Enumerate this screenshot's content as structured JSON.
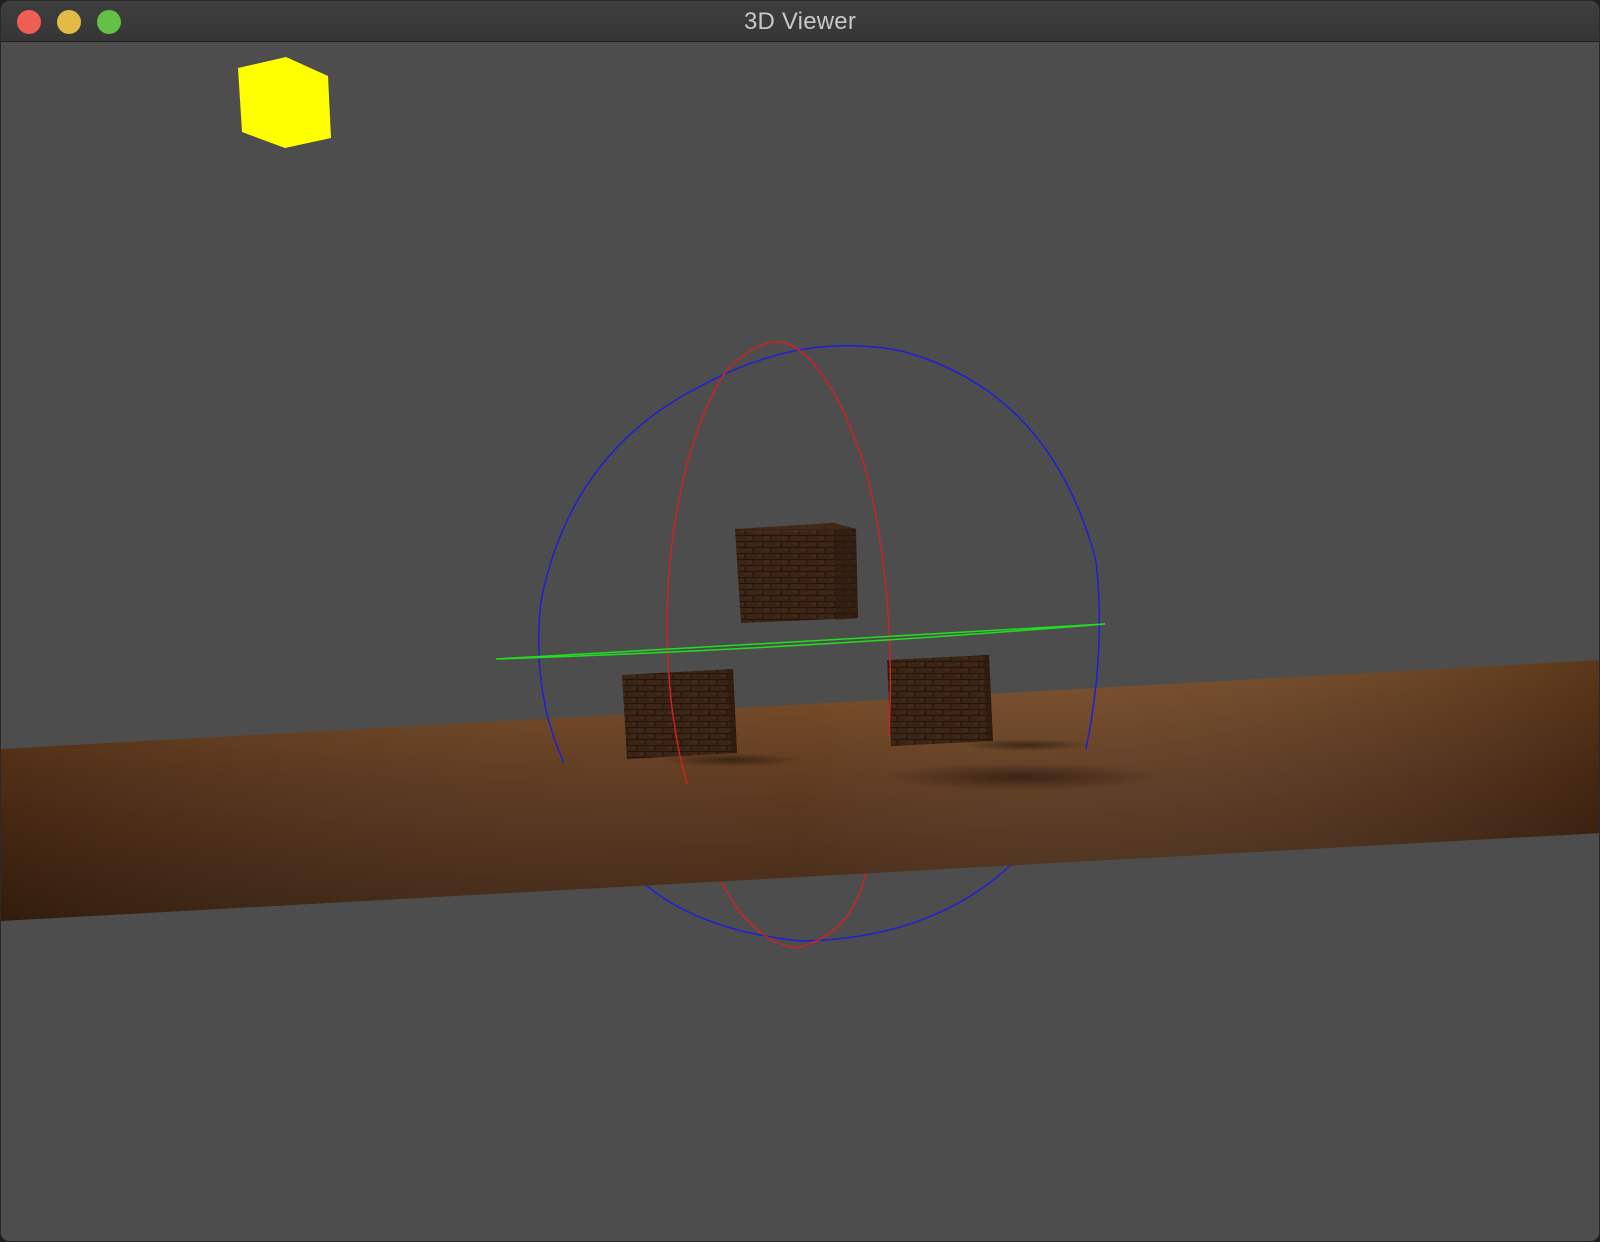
{
  "window": {
    "title": "3D Viewer",
    "background": "#4d4d4d",
    "controls": {
      "close_color": "#ee5e55",
      "minimize_color": "#e2bb46",
      "zoom_color": "#64c146"
    }
  },
  "scene": {
    "light_marker_color": "#ffff00",
    "floor_color": "#5a3418",
    "crate_color": "#3a2416",
    "gizmo": {
      "x_ring_color": "#cc2222",
      "y_ring_color": "#22dd22",
      "z_ring_color": "#1f1fd8"
    }
  }
}
